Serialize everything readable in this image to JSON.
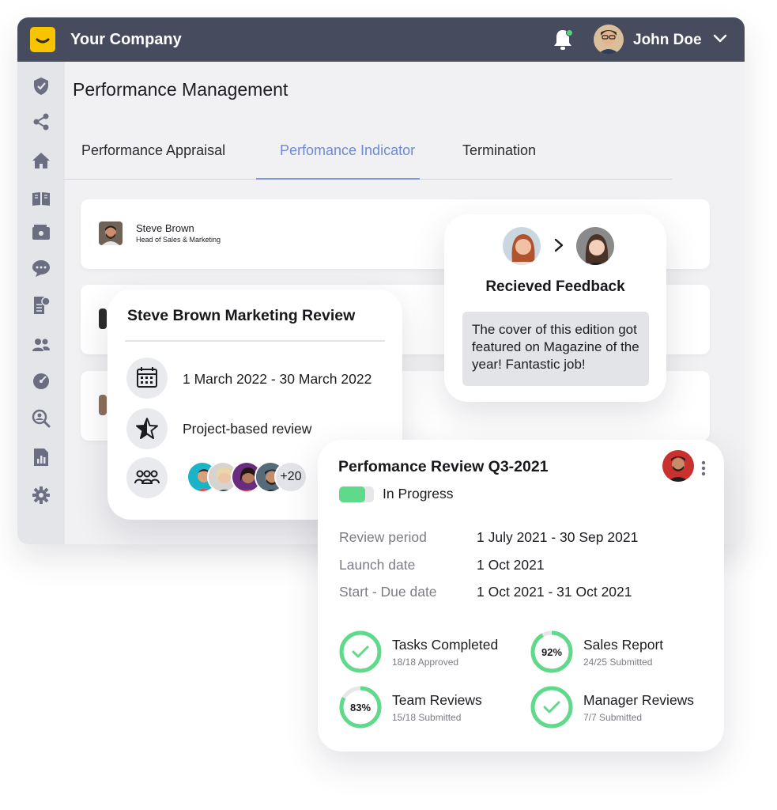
{
  "header": {
    "company": "Your Company",
    "user_name": "John Doe",
    "icons": [
      "smile-logo-icon",
      "bell-icon",
      "chevron-down-icon"
    ]
  },
  "sidebar": {
    "icons": [
      "shield-icon",
      "share-icon",
      "home-icon",
      "book-icon",
      "wallet-icon",
      "chat-icon",
      "invoice-icon",
      "people-icon",
      "speedometer-icon",
      "search-person-icon",
      "report-icon",
      "gear-icon"
    ]
  },
  "page": {
    "title": "Performance Management",
    "tabs": [
      {
        "label": "Performance Appraisal",
        "active": false
      },
      {
        "label": "Perfomance Indicator",
        "active": true
      },
      {
        "label": "Termination",
        "active": false
      }
    ]
  },
  "list": {
    "rows": [
      {
        "name": "Steve Brown",
        "role": "Head of Sales & Marketing"
      }
    ]
  },
  "review_card": {
    "title": "Steve Brown Marketing Review",
    "period": "1 March 2022 - 30 March 2022",
    "type": "Project-based review",
    "extra_members": "+20"
  },
  "feedback_card": {
    "title": "Recieved Feedback",
    "message": "The cover of this edition got featured on Magazine of the year! Fantastic job!"
  },
  "q3_card": {
    "title": "Perfomance Review Q3-2021",
    "status": "In Progress",
    "status_progress": 0.75,
    "details": [
      {
        "label": "Review period",
        "value": "1 July 2021 - 30 Sep 2021"
      },
      {
        "label": "Launch date",
        "value": "1 Oct 2021"
      },
      {
        "label": "Start - Due date",
        "value": "1 Oct 2021 - 31 Oct 2021"
      }
    ],
    "metrics": [
      {
        "title": "Tasks Completed",
        "sub": "18/18 Approved",
        "percent": 100,
        "display": "check"
      },
      {
        "title": "Sales Report",
        "sub": "24/25 Submitted",
        "percent": 92,
        "display": "92%"
      },
      {
        "title": "Team Reviews",
        "sub": "15/18 Submitted",
        "percent": 83,
        "display": "83%"
      },
      {
        "title": "Manager Reviews",
        "sub": "7/7 Submitted",
        "percent": 100,
        "display": "check"
      }
    ]
  },
  "colors": {
    "topbar": "#474b5e",
    "accent_tab": "#6d8ad6",
    "success": "#5fd98a",
    "logo": "#f8c400"
  }
}
